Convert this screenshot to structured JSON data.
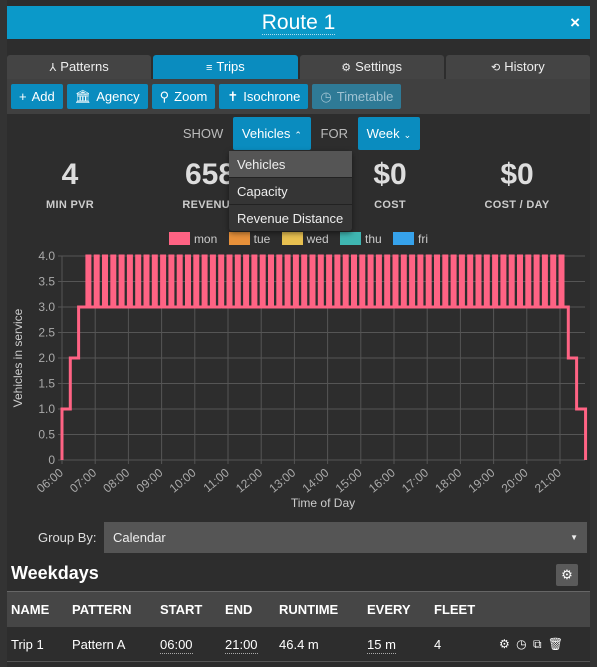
{
  "window": {
    "title": "Route 1",
    "close_label": "×"
  },
  "tabs": [
    {
      "label": "Patterns",
      "icon": "⅄",
      "icon_name": "patterns-icon",
      "active": false
    },
    {
      "label": "Trips",
      "icon": "≡",
      "icon_name": "list-icon",
      "active": true
    },
    {
      "label": "Settings",
      "icon": "⚙",
      "icon_name": "gear-icon",
      "active": false
    },
    {
      "label": "History",
      "icon": "⟲",
      "icon_name": "history-icon",
      "active": false
    }
  ],
  "toolbar": [
    {
      "label": "Add",
      "icon": "+",
      "icon_name": "plus-icon",
      "disabled": false
    },
    {
      "label": "Agency",
      "icon": "🏛",
      "icon_name": "bank-icon",
      "disabled": false
    },
    {
      "label": "Zoom",
      "icon": "⚲",
      "icon_name": "search-icon",
      "disabled": false
    },
    {
      "label": "Isochrone",
      "icon": "✝",
      "icon_name": "person-icon",
      "disabled": false
    },
    {
      "label": "Timetable",
      "icon": "◷",
      "icon_name": "clock-icon",
      "disabled": true
    }
  ],
  "show": {
    "show_label": "SHOW",
    "metric": "Vehicles",
    "metric_chevron": "⌃",
    "for_label": "FOR",
    "period": "Week",
    "period_chevron": "⌄"
  },
  "metric_menu": [
    {
      "label": "Vehicles",
      "active": true
    },
    {
      "label": "Capacity",
      "active": false
    },
    {
      "label": "Revenue Distance",
      "active": false
    }
  ],
  "stats": [
    {
      "value": "4",
      "label": "MIN PVR"
    },
    {
      "value": "658",
      "label": "REVENUE"
    },
    {
      "value": "$0",
      "label": "COST"
    },
    {
      "value": "$0",
      "label": "COST / DAY"
    }
  ],
  "chart_data": {
    "type": "line",
    "title": "",
    "xlabel": "Time of Day",
    "ylabel": "Vehicles in service",
    "ylim": [
      0,
      4
    ],
    "yticks": [
      "0",
      "0.5",
      "1.0",
      "1.5",
      "2.0",
      "2.5",
      "3.0",
      "3.5",
      "4.0"
    ],
    "xlim_hours": [
      6.0,
      21.8
    ],
    "xticks": [
      "06:00",
      "07:00",
      "08:00",
      "09:00",
      "10:00",
      "11:00",
      "12:00",
      "13:00",
      "14:00",
      "15:00",
      "16:00",
      "17:00",
      "18:00",
      "19:00",
      "20:00",
      "21:00"
    ],
    "grid": true,
    "legend": [
      {
        "name": "mon",
        "color": "#ff6384"
      },
      {
        "name": "tue",
        "color": "#e8913a"
      },
      {
        "name": "wed",
        "color": "#e8c050"
      },
      {
        "name": "thu",
        "color": "#3fb6b2"
      },
      {
        "name": "fri",
        "color": "#36a2eb"
      }
    ],
    "legend_position": "top-center",
    "series": [
      {
        "name": "mon",
        "color": "#ff6384",
        "description": "Step function: ramps 0→1 at 06:00, 2 at 06:15, 3 at 06:30; base 3 with momentary peaks of 4 every 15 min from 06:45 to 21:00; then 2 at 21:15, 1 at 21:30, 0 at 21:46",
        "ramp_up": [
          [
            6.0,
            0
          ],
          [
            6.0,
            1
          ],
          [
            6.25,
            2
          ],
          [
            6.5,
            3
          ]
        ],
        "base_level": 3,
        "peak_level": 4,
        "peak_start_hour": 6.75,
        "peak_end_hour": 21.0,
        "peak_interval_minutes": 15,
        "ramp_down": [
          [
            21.25,
            2
          ],
          [
            21.5,
            1
          ],
          [
            21.77,
            0
          ]
        ]
      }
    ]
  },
  "group_by": {
    "label": "Group By:",
    "value": "Calendar",
    "caret": "▼"
  },
  "section": {
    "title": "Weekdays",
    "settings_icon": "⚙"
  },
  "table": {
    "columns": [
      "NAME",
      "PATTERN",
      "START",
      "END",
      "RUNTIME",
      "EVERY",
      "FLEET"
    ],
    "rows": [
      {
        "name": "Trip 1",
        "pattern": "Pattern A",
        "start": "06:00",
        "end": "21:00",
        "runtime": "46.4 m",
        "every": "15 m",
        "fleet": "4"
      }
    ],
    "row_actions": [
      {
        "icon": "⚙",
        "name": "gear-icon"
      },
      {
        "icon": "◷",
        "name": "clock-icon"
      },
      {
        "icon": "⧉",
        "name": "copy-icon"
      },
      {
        "icon": "🗑",
        "name": "trash-icon"
      }
    ]
  }
}
